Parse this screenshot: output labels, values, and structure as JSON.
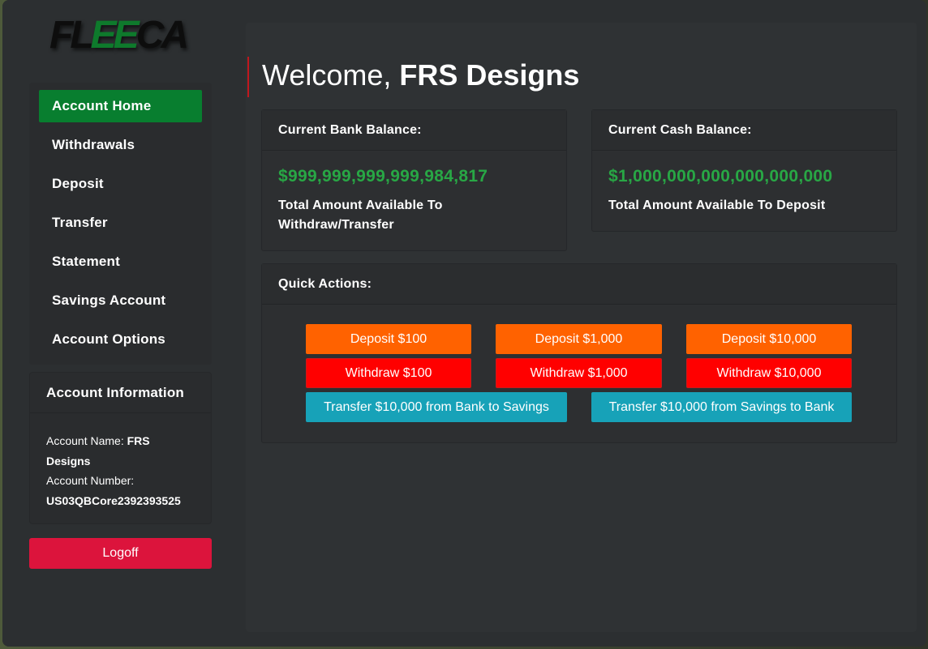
{
  "brand": {
    "logo_left": "FL",
    "logo_mid": "EE",
    "logo_right": "CA"
  },
  "sidebar": {
    "items": [
      {
        "label": "Account Home",
        "active": true
      },
      {
        "label": "Withdrawals"
      },
      {
        "label": "Deposit"
      },
      {
        "label": "Transfer"
      },
      {
        "label": "Statement"
      },
      {
        "label": "Savings Account"
      },
      {
        "label": "Account Options"
      }
    ]
  },
  "account_info": {
    "title": "Account Information",
    "name_label": "Account Name: ",
    "name_value": "FRS Designs",
    "number_label": "Account Number:",
    "number_value": "US03QBCore2392393525"
  },
  "logoff_label": "Logoff",
  "welcome": {
    "prefix": "Welcome, ",
    "name": "FRS Designs"
  },
  "bank_card": {
    "title": "Current Bank Balance:",
    "amount": "$999,999,999,999,984,817",
    "caption": "Total Amount Available To Withdraw/Transfer"
  },
  "cash_card": {
    "title": "Current Cash Balance:",
    "amount": "$1,000,000,000,000,000,000",
    "caption": "Total Amount Available To Deposit"
  },
  "quick_actions": {
    "title": "Quick Actions:",
    "deposit": [
      "Deposit $100",
      "Deposit $1,000",
      "Deposit $10,000"
    ],
    "withdraw": [
      "Withdraw $100",
      "Withdraw $1,000",
      "Withdraw $10,000"
    ],
    "transfer": [
      "Transfer $10,000 from Bank to Savings",
      "Transfer $10,000 from Savings to Bank"
    ]
  },
  "colors": {
    "accent_green": "#087e2f",
    "balance_green": "#28a745",
    "deposit_orange": "#ff6200",
    "withdraw_red": "#ff0000",
    "transfer_teal": "#17a2b8",
    "logoff_crimson": "#dc143c"
  }
}
